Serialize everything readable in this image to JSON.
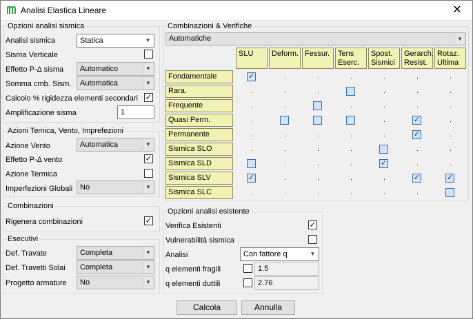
{
  "window": {
    "title": "Analisi Elastica Lineare",
    "close_glyph": "✕"
  },
  "seismic": {
    "title": "Opzioni analisi sismica",
    "analisi_sismica": {
      "label": "Analisi sismica",
      "value": "Statica"
    },
    "sisma_verticale": {
      "label": "Sisma Verticale",
      "checked": false
    },
    "effetto_pd_sisma": {
      "label": "Effetto P-Δ sisma",
      "value": "Automatico"
    },
    "somma_cmb": {
      "label": "Somma cmb. Sism.",
      "value": "Automatica"
    },
    "calcolo_rigidezza": {
      "label": "Calcolo % rigidezza elementi secondari",
      "checked": true
    },
    "amplificazione": {
      "label": "Amplificazione sisma",
      "value": "1"
    }
  },
  "azioni": {
    "title": "Azioni Temica, Vento, Imprefezioni",
    "azione_vento": {
      "label": "Azione Vento",
      "value": "Automatica"
    },
    "effetto_pd_vento": {
      "label": "Effetto P-Δ vento",
      "checked": true
    },
    "azione_termica": {
      "label": "Azione Termica",
      "checked": false
    },
    "imperfezioni": {
      "label": "Imperfezioni Globali",
      "value": "No"
    }
  },
  "combinazioni": {
    "title": "Combinazioni",
    "rigenera": {
      "label": "Rigenera combinazioni",
      "checked": true
    }
  },
  "esecutivi": {
    "title": "Esecutivi",
    "def_travate": {
      "label": "Def. Travate",
      "value": "Completa"
    },
    "def_travetti": {
      "label": "Def. Travetti Solai",
      "value": "Completa"
    },
    "progetto_armature": {
      "label": "Progetto armature",
      "value": "No"
    }
  },
  "verifiche": {
    "title": "Combinazioni & Verifiche",
    "mode": "Automatiche",
    "columns": [
      "SLU",
      "Deform.",
      "Fessur.",
      "Tens\nEserc.",
      "Spost.\nSismici",
      "Gerarch.\nResist.",
      "Rotaz.\nUltima"
    ],
    "rows": [
      {
        "label": "Fondamentale",
        "cells": [
          "checked",
          "dot",
          "dot",
          "dot",
          "dot",
          "dot",
          "dot"
        ]
      },
      {
        "label": "Rara.",
        "cells": [
          "dot",
          "dot",
          "dot",
          "box",
          "dot",
          "dot",
          "dot"
        ]
      },
      {
        "label": "Frequente",
        "cells": [
          "dot",
          "dot",
          "box",
          "dot",
          "dot",
          "dot",
          "dot"
        ]
      },
      {
        "label": "Quasi Perm.",
        "cells": [
          "dot",
          "box",
          "box",
          "box",
          "dot",
          "checked",
          "dot"
        ]
      },
      {
        "label": "Permanente",
        "cells": [
          "dot",
          "dot",
          "dot",
          "dot",
          "dot",
          "checked",
          "dot"
        ]
      },
      {
        "label": "Sismica SLO",
        "cells": [
          "dot",
          "dot",
          "dot",
          "dot",
          "box",
          "dot",
          "dot"
        ]
      },
      {
        "label": "Sismica SLD",
        "cells": [
          "box",
          "dot",
          "dot",
          "dot",
          "checked",
          "dot",
          "dot"
        ]
      },
      {
        "label": "Sismica SLV",
        "cells": [
          "checked",
          "dot",
          "dot",
          "dot",
          "dot",
          "checked",
          "checked"
        ]
      },
      {
        "label": "Sismica SLC",
        "cells": [
          "dot",
          "dot",
          "dot",
          "dot",
          "dot",
          "dot",
          "box"
        ]
      }
    ],
    "dot_glyph": ".",
    "check_glyph": "✓"
  },
  "esistente": {
    "title": "Opzioni analisi esistente",
    "verifica_esistenti": {
      "label": "Verifica Esistenti",
      "checked": true
    },
    "vulnerabilita": {
      "label": "Vulnerabilità sismica",
      "checked": false
    },
    "analisi": {
      "label": "Analisi",
      "value": "Con fattore q"
    },
    "q_fragili": {
      "label": "q elementi fragili",
      "checked": false,
      "value": "1.5"
    },
    "q_duttili": {
      "label": "q elementi duttili",
      "checked": false,
      "value": "2.76"
    }
  },
  "buttons": {
    "calcola": "Calcola",
    "annulla": "Annulla"
  },
  "colors": {
    "header_yellow": "#f2f2b4",
    "app_icon_green": "#2aa640",
    "mark_blue": "#cfe4f8"
  }
}
